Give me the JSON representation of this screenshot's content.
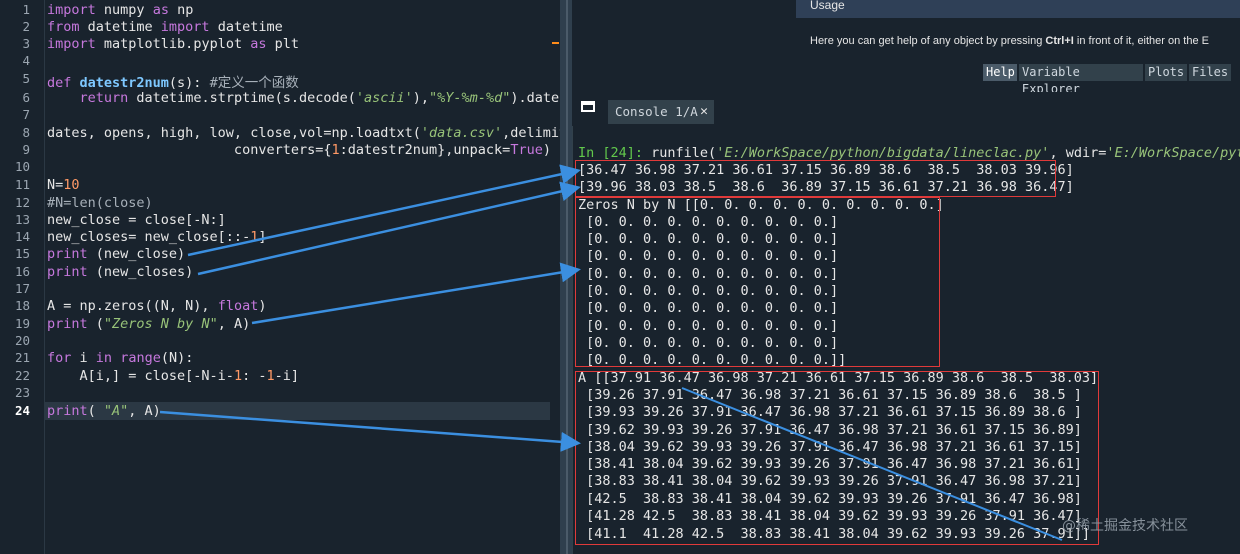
{
  "editor": {
    "line_numbers": [
      "1",
      "2",
      "3",
      "4",
      "5",
      "6",
      "7",
      "8",
      "9",
      "10",
      "11",
      "12",
      "13",
      "14",
      "15",
      "16",
      "17",
      "18",
      "19",
      "20",
      "21",
      "22",
      "23",
      "24"
    ],
    "current_line": "24",
    "lines": {
      "l1": {
        "a": "import",
        "b": " numpy ",
        "c": "as",
        "d": " np"
      },
      "l2": {
        "a": "from",
        "b": " datetime ",
        "c": "import",
        "d": " datetime"
      },
      "l3": {
        "a": "import",
        "b": " matplotlib.pyplot ",
        "c": "as",
        "d": " plt"
      },
      "l5": {
        "a": "def ",
        "b": "datestr2num",
        "c": "(s): ",
        "d": "#定义一个函数"
      },
      "l6": {
        "a": "    ",
        "b": "return",
        "c": " datetime.strptime(s.decode(",
        "d": "'ascii'",
        "e": "),",
        "f": "\"%Y-%m-%d\"",
        "g": ").date()"
      },
      "l8": {
        "a": "dates, opens, high, low, close,vol=np.loadtxt(",
        "b": "'data.csv'",
        "c": ",delimite"
      },
      "l9": {
        "a": "                       converters={",
        "b": "1",
        "c": ":datestr2num},unpack=",
        "d": "True",
        "e": ")"
      },
      "l11": {
        "a": "N=",
        "b": "10"
      },
      "l12": "#N=len(close)",
      "l13": {
        "a": "new_close = close[-N:]"
      },
      "l14": {
        "a": "new_closes= new_close[::-",
        "b": "1",
        "c": "]"
      },
      "l15": {
        "a": "print",
        "b": " (new_close)"
      },
      "l16": {
        "a": "print",
        "b": " (new_closes)"
      },
      "l18": {
        "a": "A = np.zeros((N, N), ",
        "b": "float",
        "c": ")"
      },
      "l19": {
        "a": "print",
        "b": " (",
        "c": "\"Zeros N by N\"",
        "d": ", A)"
      },
      "l21": {
        "a": "for",
        "b": " i ",
        "c": "in",
        "d": " ",
        "e": "range",
        "f": "(N):"
      },
      "l22": {
        "a": "    A[i,] = close[-N-i-",
        "b": "1",
        "c": ": -",
        "d": "1",
        "e": "-i]"
      },
      "l24": {
        "a": "print",
        "b": "( ",
        "c": "\"A\"",
        "d": ", A)"
      }
    }
  },
  "help_pane": {
    "title": "Usage",
    "text_pre": "Here you can get help of any object by pressing ",
    "text_key": "Ctrl+I",
    "text_post": " in front of it, either on the E"
  },
  "pane_tabs": [
    "Help",
    "Variable Explorer",
    "Plots",
    "Files"
  ],
  "console": {
    "tab_label": "Console 1/A",
    "close_glyph": "✕",
    "prompt": "In [24]:",
    "command": " runfile(",
    "arg1": "'E:/WorkSpace/python/bigdata/lineclac.py'",
    "sep": ", wdir=",
    "arg2": "'E:/WorkSpace/python",
    "output": [
      "[36.47 36.98 37.21 36.61 37.15 36.89 38.6  38.5  38.03 39.96]",
      "[39.96 38.03 38.5  38.6  36.89 37.15 36.61 37.21 36.98 36.47]",
      "Zeros N by N [[0. 0. 0. 0. 0. 0. 0. 0. 0. 0.]",
      " [0. 0. 0. 0. 0. 0. 0. 0. 0. 0.]",
      " [0. 0. 0. 0. 0. 0. 0. 0. 0. 0.]",
      " [0. 0. 0. 0. 0. 0. 0. 0. 0. 0.]",
      " [0. 0. 0. 0. 0. 0. 0. 0. 0. 0.]",
      " [0. 0. 0. 0. 0. 0. 0. 0. 0. 0.]",
      " [0. 0. 0. 0. 0. 0. 0. 0. 0. 0.]",
      " [0. 0. 0. 0. 0. 0. 0. 0. 0. 0.]",
      " [0. 0. 0. 0. 0. 0. 0. 0. 0. 0.]",
      " [0. 0. 0. 0. 0. 0. 0. 0. 0. 0.]]",
      "A [[37.91 36.47 36.98 37.21 36.61 37.15 36.89 38.6  38.5  38.03]",
      " [39.26 37.91 36.47 36.98 37.21 36.61 37.15 36.89 38.6  38.5 ]",
      " [39.93 39.26 37.91 36.47 36.98 37.21 36.61 37.15 36.89 38.6 ]",
      " [39.62 39.93 39.26 37.91 36.47 36.98 37.21 36.61 37.15 36.89]",
      " [38.04 39.62 39.93 39.26 37.91 36.47 36.98 37.21 36.61 37.15]",
      " [38.41 38.04 39.62 39.93 39.26 37.91 36.47 36.98 37.21 36.61]",
      " [38.83 38.41 38.04 39.62 39.93 39.26 37.91 36.47 36.98 37.21]",
      " [42.5  38.83 38.41 38.04 39.62 39.93 39.26 37.91 36.47 36.98]",
      " [41.28 42.5  38.83 38.41 38.04 39.62 39.93 39.26 37.91 36.47]",
      " [41.1  41.28 42.5  38.83 38.41 38.04 39.62 39.93 39.26 37.91]]"
    ]
  },
  "watermark": "@稀土掘金技术社区",
  "colors": {
    "arrow": "#3b8fe0",
    "box": "#e03a3a",
    "background": "#19232d"
  }
}
